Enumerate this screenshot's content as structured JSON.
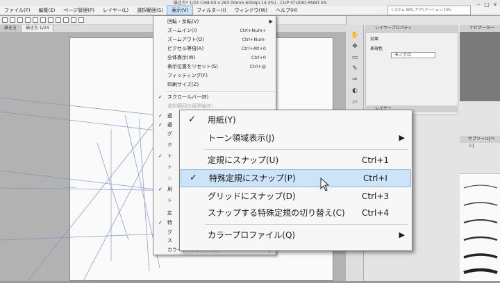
{
  "window": {
    "title": "描き方* 1/24 (168.00 x 263.00mm 600dpi 14.3%) - CLIP STUDIO PAINT EX",
    "status_box": "システム 60%  アプリケーション 13%"
  },
  "menubar": {
    "items": [
      {
        "label": "ファイル(F)"
      },
      {
        "label": "編集(E)"
      },
      {
        "label": "ページ管理(P)"
      },
      {
        "label": "レイヤー(L)"
      },
      {
        "label": "選択範囲(S)"
      },
      {
        "label": "表示(V)"
      },
      {
        "label": "フィルター(I)"
      },
      {
        "label": "ウィンドウ(W)"
      },
      {
        "label": "ヘルプ(H)"
      }
    ],
    "active_index": 5
  },
  "tabs": [
    {
      "label": "描き方"
    },
    {
      "label": "描き方 1/24"
    }
  ],
  "panels": {
    "properties_title": "レイヤープロパティ",
    "properties_effect": "効果",
    "properties_color_label": "表現色",
    "properties_color_value": "モノクロ",
    "navigator_title": "ナビゲーター",
    "layer_title": "レイヤー",
    "subtool_title": "サブツール[ペン]"
  },
  "view_menu": {
    "items": [
      {
        "label": "回転・反転(V)",
        "shortcut": "",
        "checked": false,
        "disabled": false,
        "submenu": true
      },
      {
        "label": "ズームイン(I)",
        "shortcut": "Ctrl+Num+",
        "checked": false,
        "disabled": false,
        "submenu": false
      },
      {
        "label": "ズームアウト(O)",
        "shortcut": "Ctrl+Num-",
        "checked": false,
        "disabled": false,
        "submenu": false
      },
      {
        "label": "ピクセル等倍(A)",
        "shortcut": "Ctrl+Alt+0",
        "checked": false,
        "disabled": false,
        "submenu": false
      },
      {
        "label": "全体表示(W)",
        "shortcut": "Ctrl+0",
        "checked": false,
        "disabled": false,
        "submenu": false
      },
      {
        "label": "表示位置をリセット(S)",
        "shortcut": "Ctrl+@",
        "checked": false,
        "disabled": false,
        "submenu": false
      },
      {
        "label": "フィッティング(F)",
        "shortcut": "",
        "checked": false,
        "disabled": false,
        "submenu": false
      },
      {
        "label": "印刷サイズ(Z)",
        "shortcut": "",
        "checked": false,
        "disabled": false,
        "submenu": false
      },
      {
        "label": "スクロールバー(B)",
        "shortcut": "",
        "checked": true,
        "disabled": false,
        "submenu": false
      },
      {
        "label": "選択範囲の境界線(E)",
        "shortcut": "",
        "checked": false,
        "disabled": true,
        "submenu": false
      },
      {
        "label": "カラープロファイル(Q)",
        "shortcut": "",
        "checked": false,
        "disabled": false,
        "submenu": true
      }
    ],
    "partial_items": [
      "選",
      "選",
      "グ",
      "ク",
      "ト",
      "ト",
      "ル",
      "用",
      "ト",
      "定",
      "特",
      "グ",
      "ス"
    ]
  },
  "snap_submenu": {
    "items": [
      {
        "label": "用紙(Y)",
        "shortcut": "",
        "checked": true,
        "highlighted": false,
        "submenu": false
      },
      {
        "label": "トーン領域表示(J)",
        "shortcut": "",
        "checked": false,
        "highlighted": false,
        "submenu": true
      },
      {
        "label": "定規にスナップ(U)",
        "shortcut": "Ctrl+1",
        "checked": false,
        "highlighted": false,
        "submenu": false
      },
      {
        "label": "特殊定規にスナップ(P)",
        "shortcut": "Ctrl+I",
        "checked": true,
        "highlighted": true,
        "submenu": false
      },
      {
        "label": "グリッドにスナップ(D)",
        "shortcut": "Ctrl+3",
        "checked": false,
        "highlighted": false,
        "submenu": false
      },
      {
        "label": "スナップする特殊定規の切り替え(C)",
        "shortcut": "Ctrl+4",
        "checked": false,
        "highlighted": false,
        "submenu": false
      },
      {
        "label": "カラープロファイル(Q)",
        "shortcut": "",
        "checked": false,
        "highlighted": false,
        "submenu": true
      }
    ]
  },
  "glyphs": {
    "check": "✓",
    "arrow": "▶"
  },
  "colors": {
    "highlight": "#cde4f8",
    "menu_active": "#cfe3f7"
  }
}
